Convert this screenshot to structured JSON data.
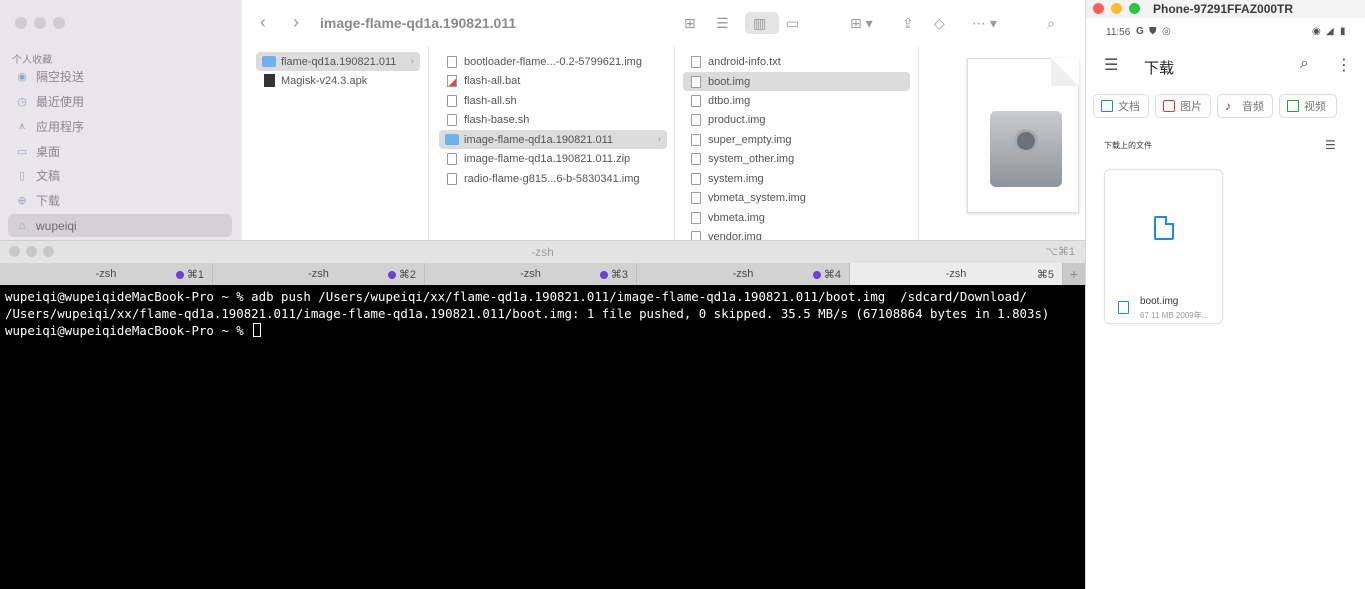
{
  "finder": {
    "title": "image-flame-qd1a.190821.011",
    "sidebar": {
      "section": "个人收藏",
      "items": [
        {
          "label": "隔空投送",
          "icon": "airdrop-icon"
        },
        {
          "label": "最近使用",
          "icon": "clock-icon"
        },
        {
          "label": "应用程序",
          "icon": "applications-icon"
        },
        {
          "label": "桌面",
          "icon": "desktop-icon"
        },
        {
          "label": "文稿",
          "icon": "document-icon"
        },
        {
          "label": "下载",
          "icon": "download-icon"
        },
        {
          "label": "wupeiqi",
          "icon": "home-icon"
        }
      ],
      "selected": "wupeiqi"
    },
    "column1": [
      "flame-qd1a.190821.011",
      "Magisk-v24.3.apk"
    ],
    "column2": [
      "bootloader-flame...-0.2-5799621.img",
      "flash-all.bat",
      "flash-all.sh",
      "flash-base.sh",
      "image-flame-qd1a.190821.011",
      "image-flame-qd1a.190821.011.zip",
      "radio-flame-g815...6-b-5830341.img"
    ],
    "column3": [
      "android-info.txt",
      "boot.img",
      "dtbo.img",
      "product.img",
      "super_empty.img",
      "system_other.img",
      "system.img",
      "vbmeta_system.img",
      "vbmeta.img",
      "vendor.img"
    ]
  },
  "terminal": {
    "title": "-zsh",
    "shortcut": "⌥⌘1",
    "tabs": [
      {
        "label": "-zsh",
        "shortcut": "⌘1",
        "dot": true
      },
      {
        "label": "-zsh",
        "shortcut": "⌘2",
        "dot": true
      },
      {
        "label": "-zsh",
        "shortcut": "⌘3",
        "dot": true
      },
      {
        "label": "-zsh",
        "shortcut": "⌘4",
        "dot": true
      },
      {
        "label": "-zsh",
        "shortcut": "⌘5",
        "dot": false
      }
    ],
    "plus": "+",
    "lines": [
      "wupeiqi@wupeiqideMacBook-Pro ~ % adb push /Users/wupeiqi/xx/flame-qd1a.190821.011/image-flame-qd1a.190821.011/boot.img  /sdcard/Download/",
      "/Users/wupeiqi/xx/flame-qd1a.190821.011/image-flame-qd1a.190821.011/boot.img: 1 file pushed, 0 skipped. 35.5 MB/s (67108864 bytes in 1.803s)",
      "wupeiqi@wupeiqideMacBook-Pro ~ % "
    ]
  },
  "phone": {
    "window_title": "Phone-97291FFAZ000TR",
    "status_time": "11:56",
    "status_g": "G",
    "app_title": "下载",
    "chips": [
      {
        "label": "文档",
        "color": "#1a8ae8"
      },
      {
        "label": "图片",
        "color": "#e53935"
      },
      {
        "label": "音频",
        "color": "#8e24aa"
      },
      {
        "label": "视频",
        "color": "#1e9e4a"
      }
    ],
    "section": "下载上的文件",
    "file": {
      "name": "boot.img",
      "meta": "67.11 MB 2009年..."
    }
  }
}
